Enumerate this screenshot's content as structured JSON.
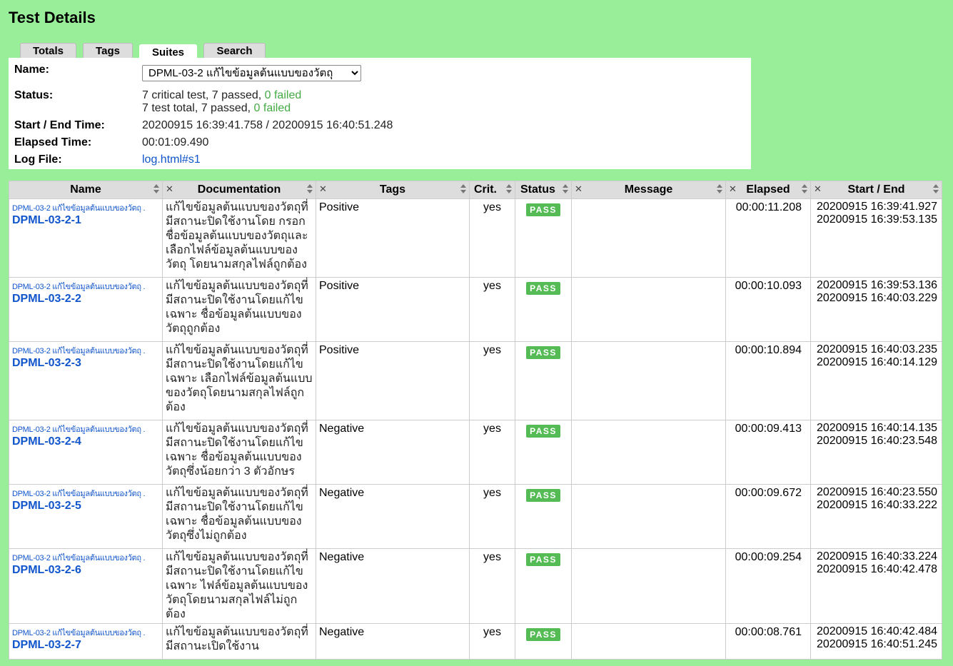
{
  "page_title": "Test Details",
  "tabs": [
    "Totals",
    "Tags",
    "Suites",
    "Search"
  ],
  "active_tab": "Suites",
  "details": {
    "name_label": "Name:",
    "name_value": "DPML-03-2 แก้ไขข้อมูลต้นแบบของวัตถุ",
    "status_label": "Status:",
    "status_line1_prefix": "7 critical test, 7 passed, ",
    "status_line1_fail": "0 failed",
    "status_line2_prefix": "7 test total, 7 passed, ",
    "status_line2_fail": "0 failed",
    "time_label": "Start / End Time:",
    "time_value": "20200915 16:39:41.758 / 20200915 16:40:51.248",
    "elapsed_label": "Elapsed Time:",
    "elapsed_value": "00:01:09.490",
    "log_label": "Log File:",
    "log_value": "log.html#s1"
  },
  "table": {
    "headers": [
      "Name",
      "Documentation",
      "Tags",
      "Crit.",
      "Status",
      "Message",
      "Elapsed",
      "Start / End"
    ],
    "rows": [
      {
        "parent": "DPML-03-2 แก้ไขข้อมูลต้นแบบของวัตถุ .",
        "name": "DPML-03-2-1",
        "doc": "แก้ไขข้อมูลต้นแบบของวัตถุที่มีสถานะปิดใช้งานโดย กรอกชื่อข้อมูลต้นแบบของวัตถุและเลือกไฟล์ข้อมูลต้นแบบของวัตถุ โดยนามสกุลไฟล์ถูกต้อง",
        "tags": "Positive",
        "crit": "yes",
        "status": "PASS",
        "message": "",
        "elapsed": "00:00:11.208",
        "start": "20200915 16:39:41.927",
        "end": "20200915 16:39:53.135"
      },
      {
        "parent": "DPML-03-2 แก้ไขข้อมูลต้นแบบของวัตถุ .",
        "name": "DPML-03-2-2",
        "doc": "แก้ไขข้อมูลต้นแบบของวัตถุที่มีสถานะปิดใช้งานโดยแก้ไขเฉพาะ ชื่อข้อมูลต้นแบบของวัตถุถูกต้อง",
        "tags": "Positive",
        "crit": "yes",
        "status": "PASS",
        "message": "",
        "elapsed": "00:00:10.093",
        "start": "20200915 16:39:53.136",
        "end": "20200915 16:40:03.229"
      },
      {
        "parent": "DPML-03-2 แก้ไขข้อมูลต้นแบบของวัตถุ .",
        "name": "DPML-03-2-3",
        "doc": "แก้ไขข้อมูลต้นแบบของวัตถุที่มีสถานะปิดใช้งานโดยแก้ไขเฉพาะ เลือกไฟล์ข้อมูลต้นแบบของวัตถุโดยนามสกุลไฟล์ถูกต้อง",
        "tags": "Positive",
        "crit": "yes",
        "status": "PASS",
        "message": "",
        "elapsed": "00:00:10.894",
        "start": "20200915 16:40:03.235",
        "end": "20200915 16:40:14.129"
      },
      {
        "parent": "DPML-03-2 แก้ไขข้อมูลต้นแบบของวัตถุ .",
        "name": "DPML-03-2-4",
        "doc": "แก้ไขข้อมูลต้นแบบของวัตถุที่มีสถานะปิดใช้งานโดยแก้ไขเฉพาะ ชื่อข้อมูลต้นแบบของวัตถุซึ่งน้อยกว่า 3 ตัวอักษร",
        "tags": "Negative",
        "crit": "yes",
        "status": "PASS",
        "message": "",
        "elapsed": "00:00:09.413",
        "start": "20200915 16:40:14.135",
        "end": "20200915 16:40:23.548"
      },
      {
        "parent": "DPML-03-2 แก้ไขข้อมูลต้นแบบของวัตถุ .",
        "name": "DPML-03-2-5",
        "doc": "แก้ไขข้อมูลต้นแบบของวัตถุที่มีสถานะปิดใช้งานโดยแก้ไขเฉพาะ ชื่อข้อมูลต้นแบบของวัตถุซึ่งไม่ถูกต้อง",
        "tags": "Negative",
        "crit": "yes",
        "status": "PASS",
        "message": "",
        "elapsed": "00:00:09.672",
        "start": "20200915 16:40:23.550",
        "end": "20200915 16:40:33.222"
      },
      {
        "parent": "DPML-03-2 แก้ไขข้อมูลต้นแบบของวัตถุ .",
        "name": "DPML-03-2-6",
        "doc": "แก้ไขข้อมูลต้นแบบของวัตถุที่มีสถานะปิดใช้งานโดยแก้ไขเฉพาะ ไฟล์ข้อมูลต้นแบบของวัตถุโดยนามสกุลไฟล์ไม่ถูกต้อง",
        "tags": "Negative",
        "crit": "yes",
        "status": "PASS",
        "message": "",
        "elapsed": "00:00:09.254",
        "start": "20200915 16:40:33.224",
        "end": "20200915 16:40:42.478"
      },
      {
        "parent": "DPML-03-2 แก้ไขข้อมูลต้นแบบของวัตถุ .",
        "name": "DPML-03-2-7",
        "doc": "แก้ไขข้อมูลต้นแบบของวัตถุที่มีสถานะเปิดใช้งาน",
        "tags": "Negative",
        "crit": "yes",
        "status": "PASS",
        "message": "",
        "elapsed": "00:00:08.761",
        "start": "20200915 16:40:42.484",
        "end": "20200915 16:40:51.245"
      }
    ]
  },
  "colors": {
    "background": "#99ef99",
    "pass_badge": "#55bb55",
    "link": "#1155cc"
  },
  "icons": {
    "sort": "sort-arrows-icon",
    "hide_column": "close-icon",
    "dropdown": "chevron-down-icon"
  }
}
